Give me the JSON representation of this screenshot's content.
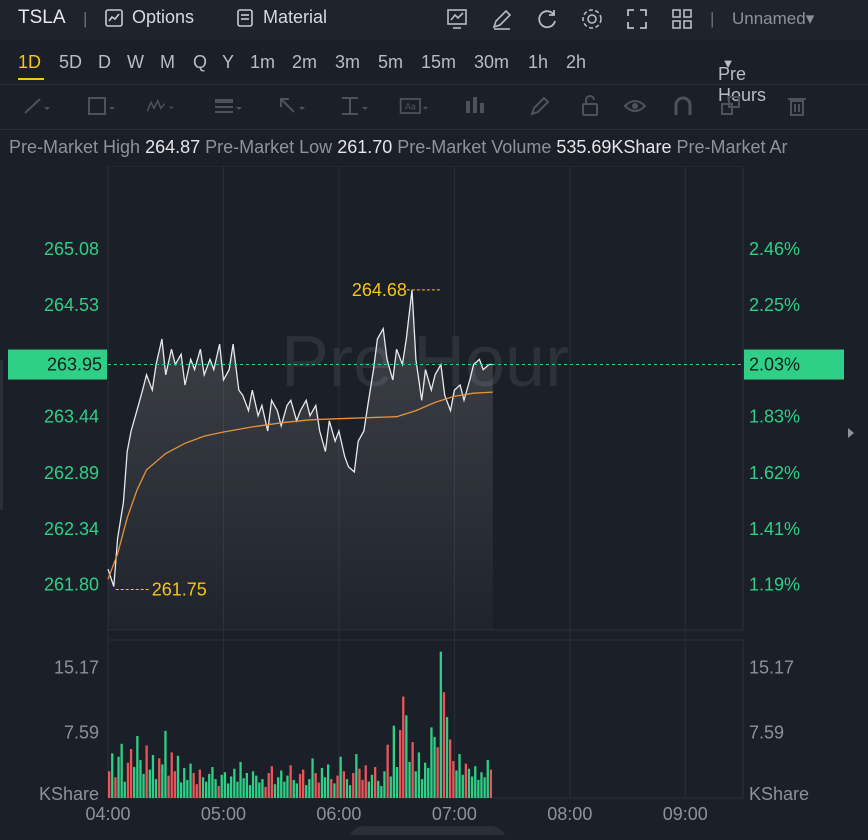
{
  "header": {
    "symbol": "TSLA",
    "options_label": "Options",
    "material_label": "Material",
    "layout_name": "Unnamed"
  },
  "timeframes": [
    "1D",
    "5D",
    "D",
    "W",
    "M",
    "Q",
    "Y",
    "1m",
    "2m",
    "3m",
    "5m",
    "15m",
    "30m",
    "1h",
    "2h"
  ],
  "active_timeframe": "1D",
  "session_select": "Pre Hours",
  "info_bar": [
    {
      "label": "Pre-Market High",
      "value": "264.87"
    },
    {
      "label": "Pre-Market Low",
      "value": "261.70"
    },
    {
      "label": "Pre-Market Volume",
      "value": "535.69KShare"
    },
    {
      "label": "Pre-Market Ar",
      "value": ""
    }
  ],
  "watermark": "Pre Hour",
  "colors": {
    "up": "#2fcf87",
    "down": "#e8565a",
    "accent": "#f5c518",
    "avg_line": "#e8923a",
    "price_line": "#e8e9ec"
  },
  "chart_data": {
    "type": "line",
    "price_axis": {
      "left_ticks": [
        "265.08",
        "264.53",
        "263.95",
        "263.44",
        "262.89",
        "262.34",
        "261.80"
      ],
      "right_ticks": [
        "2.46%",
        "2.25%",
        "2.03%",
        "1.83%",
        "1.62%",
        "1.41%",
        "1.19%"
      ],
      "ylim": [
        261.55,
        265.5
      ]
    },
    "volume_axis": {
      "ticks": [
        "15.17",
        "7.59"
      ],
      "unit": "KShare",
      "ylim": [
        0,
        17.2
      ]
    },
    "x_ticks": [
      "04:00",
      "05:00",
      "06:00",
      "07:00",
      "08:00",
      "09:00"
    ],
    "current_price": "263.95",
    "current_change": "2.03%",
    "annotations": [
      {
        "label": "264.68",
        "time": "06:53",
        "value": 264.68
      },
      {
        "label": "261.75",
        "time": "04:04",
        "value": 261.75
      }
    ],
    "series": [
      {
        "name": "Price",
        "x": [
          "04:00",
          "04:03",
          "04:05",
          "04:08",
          "04:10",
          "04:12",
          "04:15",
          "04:18",
          "04:20",
          "04:23",
          "04:25",
          "04:28",
          "04:30",
          "04:33",
          "04:35",
          "04:38",
          "04:40",
          "04:43",
          "04:45",
          "04:48",
          "04:50",
          "04:53",
          "04:55",
          "04:58",
          "05:00",
          "05:03",
          "05:05",
          "05:08",
          "05:10",
          "05:13",
          "05:15",
          "05:18",
          "05:20",
          "05:23",
          "05:25",
          "05:28",
          "05:30",
          "05:33",
          "05:35",
          "05:38",
          "05:40",
          "05:43",
          "05:45",
          "05:48",
          "05:50",
          "05:53",
          "05:55",
          "05:58",
          "06:00",
          "06:03",
          "06:05",
          "06:08",
          "06:10",
          "06:13",
          "06:15",
          "06:18",
          "06:20",
          "06:23",
          "06:25",
          "06:28",
          "06:30",
          "06:33",
          "06:35",
          "06:38",
          "06:40",
          "06:43",
          "06:45",
          "06:48",
          "06:50",
          "06:53",
          "06:55",
          "06:58",
          "07:00",
          "07:03",
          "07:05",
          "07:08",
          "07:10",
          "07:13",
          "07:15",
          "07:18",
          "07:20"
        ],
        "values": [
          261.95,
          261.78,
          262.25,
          262.6,
          263.1,
          263.3,
          263.5,
          263.7,
          263.85,
          263.7,
          263.95,
          264.2,
          263.85,
          264.1,
          263.95,
          264.05,
          263.75,
          264.0,
          263.9,
          264.1,
          263.85,
          264.0,
          263.9,
          264.15,
          263.8,
          263.9,
          264.15,
          263.7,
          263.65,
          263.5,
          263.7,
          263.45,
          263.55,
          263.3,
          263.6,
          263.5,
          263.35,
          263.55,
          263.6,
          263.4,
          263.5,
          263.6,
          263.45,
          263.55,
          263.3,
          263.1,
          263.4,
          263.2,
          263.3,
          263.05,
          262.95,
          262.9,
          263.2,
          263.3,
          263.55,
          263.9,
          264.2,
          264.3,
          264.0,
          263.8,
          264.1,
          263.95,
          264.2,
          264.68,
          264.0,
          263.6,
          263.9,
          263.7,
          263.85,
          263.95,
          263.65,
          263.5,
          263.7,
          263.75,
          263.6,
          263.8,
          263.95,
          264.0,
          263.9,
          263.95,
          263.95
        ]
      },
      {
        "name": "Avg",
        "x": [
          "04:00",
          "04:05",
          "04:10",
          "04:15",
          "04:20",
          "04:30",
          "04:40",
          "04:50",
          "05:00",
          "05:15",
          "05:30",
          "05:45",
          "06:00",
          "06:15",
          "06:30",
          "06:40",
          "06:50",
          "07:00",
          "07:10",
          "07:20"
        ],
        "values": [
          261.85,
          262.1,
          262.45,
          262.72,
          262.92,
          263.08,
          263.18,
          263.25,
          263.29,
          263.34,
          263.38,
          263.41,
          263.42,
          263.43,
          263.44,
          263.5,
          263.58,
          263.64,
          263.67,
          263.68
        ]
      }
    ],
    "volume": {
      "colors_note": "green up / red down",
      "values": [
        3.1,
        5.2,
        2.4,
        4.8,
        6.3,
        1.9,
        4.1,
        5.7,
        3.6,
        7.2,
        4.4,
        2.8,
        6.1,
        3.3,
        5.0,
        2.2,
        4.6,
        3.9,
        7.8,
        2.6,
        5.3,
        3.1,
        4.9,
        1.8,
        3.5,
        2.1,
        4.0,
        2.9,
        1.6,
        3.3,
        2.4,
        1.9,
        2.8,
        3.6,
        2.2,
        1.4,
        2.7,
        3.0,
        1.7,
        2.5,
        3.4,
        1.9,
        4.2,
        2.3,
        2.9,
        1.5,
        3.1,
        2.6,
        1.8,
        2.2,
        1.3,
        2.9,
        3.7,
        1.6,
        2.4,
        3.2,
        1.9,
        2.6,
        3.8,
        2.1,
        1.7,
        2.8,
        3.3,
        1.5,
        2.2,
        4.6,
        2.9,
        1.8,
        3.5,
        2.4,
        3.9,
        2.2,
        1.7,
        2.6,
        4.8,
        3.1,
        2.2,
        1.5,
        2.9,
        5.1,
        3.4,
        2.1,
        3.8,
        1.9,
        2.7,
        3.6,
        2.0,
        1.4,
        3.1,
        6.2,
        2.5,
        8.4,
        3.6,
        7.9,
        11.8,
        9.6,
        4.2,
        6.5,
        3.1,
        5.3,
        2.2,
        4.1,
        3.5,
        8.2,
        7.1,
        5.9,
        17.0,
        12.3,
        9.4,
        6.8,
        4.3,
        3.2,
        5.1,
        2.7,
        4.0,
        3.4,
        2.5,
        3.7,
        2.1,
        3.0,
        2.4,
        4.4,
        3.3
      ]
    }
  }
}
